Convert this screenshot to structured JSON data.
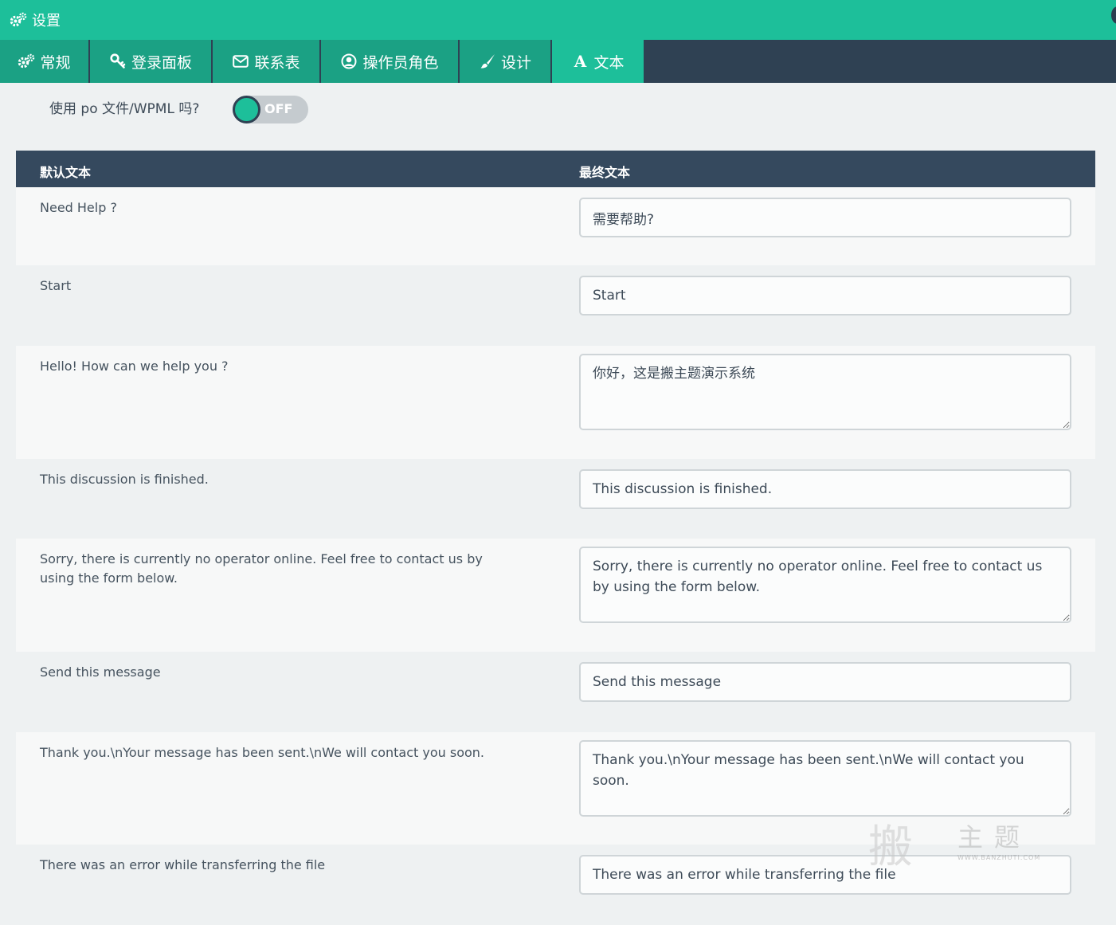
{
  "header": {
    "title": "设置",
    "icon": "gears-icon"
  },
  "tabs": [
    {
      "label": "常规",
      "icon": "gears-icon"
    },
    {
      "label": "登录面板",
      "icon": "key-icon"
    },
    {
      "label": "联系表",
      "icon": "envelope-icon"
    },
    {
      "label": "操作员角色",
      "icon": "user-circle-icon"
    },
    {
      "label": "设计",
      "icon": "paintbrush-icon"
    },
    {
      "label": "文本",
      "icon": "font-icon",
      "glyph": "A",
      "active": true
    }
  ],
  "po_setting": {
    "label": "使用 po 文件/WPML 吗?",
    "toggle_text": "OFF",
    "toggle_state": "off"
  },
  "table": {
    "headers": {
      "default": "默认文本",
      "final": "最终文本"
    },
    "rows": [
      {
        "default": "Need Help ?",
        "final": "需要帮助?"
      },
      {
        "default": "Start",
        "final": "Start"
      },
      {
        "default": "Hello! How can we help you ?",
        "final": "你好，这是搬主题演示系统"
      },
      {
        "default": "This discussion is finished.",
        "final": "This discussion is finished."
      },
      {
        "default": "Sorry, there is currently no operator online. Feel free to contact us by using the form below.",
        "final": "Sorry, there is currently no operator online. Feel free to contact us by using the form below."
      },
      {
        "default": "Send this message",
        "final": "Send this message"
      },
      {
        "default": "Thank you.\\nYour message has been sent.\\nWe will contact you soon.",
        "final": "Thank you.\\nYour message has been sent.\\nWe will contact you soon."
      },
      {
        "default": "There was an error while transferring the file",
        "final": "There was an error while transferring the file"
      }
    ]
  },
  "watermark": {
    "big": "搬",
    "text": "主题",
    "url": "WWW.BANZHUTI.COM"
  },
  "colors": {
    "accent": "#1dbf9a",
    "tab_bg": "#1ba184",
    "dark": "#2f4153",
    "header_row": "#35495e"
  }
}
